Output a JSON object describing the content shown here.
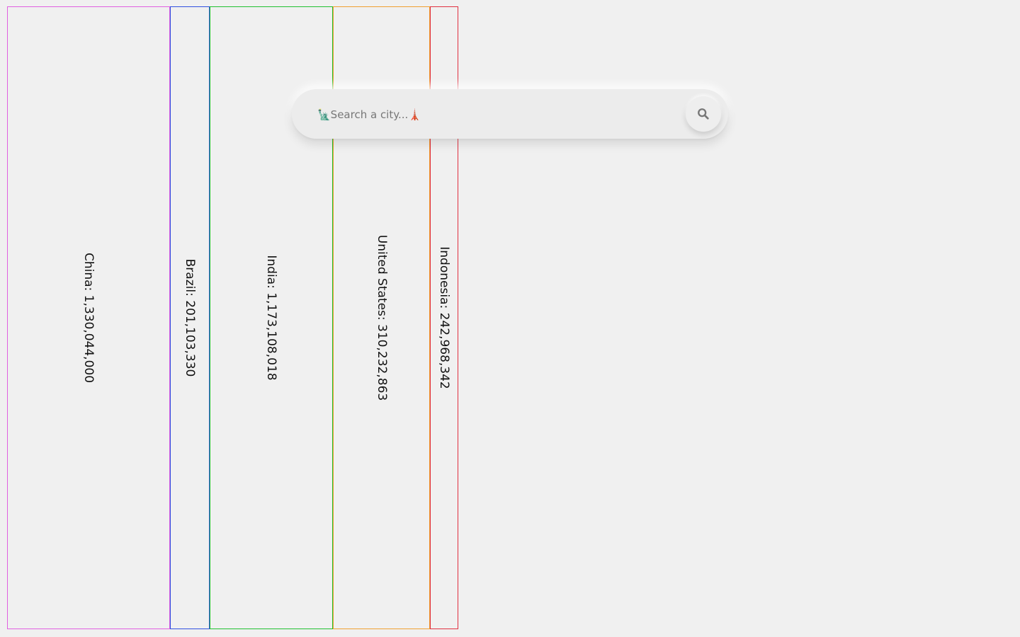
{
  "columns": [
    {
      "label": "China: 1,330,044,000",
      "color": "#e060e0"
    },
    {
      "label": "Brazil: 201,103,330",
      "color": "#3050e0"
    },
    {
      "label": "India: 1,173,108,018",
      "color": "#20c030"
    },
    {
      "label": "United States: 310,232,863",
      "color": "#f0a030"
    },
    {
      "label": "Indonesia: 242,968,342",
      "color": "#e03040"
    }
  ],
  "search": {
    "placeholder": "🗽Search a city...🗼",
    "value": "",
    "button_icon": "search-icon"
  }
}
